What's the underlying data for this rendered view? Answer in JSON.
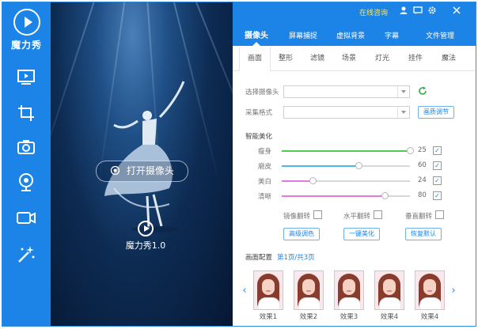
{
  "app": {
    "logo_text": "魔力秀",
    "brand_text": "魔力秀1.0",
    "accent": "#1b84e6"
  },
  "sidebar": {
    "items": [
      {
        "icon": "monitor-play-icon"
      },
      {
        "icon": "crop-screen-icon"
      },
      {
        "icon": "camera-icon"
      },
      {
        "icon": "webcam-icon"
      },
      {
        "icon": "video-camera-icon"
      },
      {
        "icon": "magic-wand-icon"
      }
    ]
  },
  "preview": {
    "open_camera_label": "打开摄像头"
  },
  "topbar": {
    "online_help": "在线咨询",
    "icons": [
      "user-icon",
      "message-icon",
      "gear-icon",
      "close-icon"
    ]
  },
  "tabs": [
    {
      "label": "摄像头",
      "active": true
    },
    {
      "label": "屏幕捕捉",
      "active": false
    },
    {
      "label": "虚拟背景",
      "active": false
    },
    {
      "label": "字幕",
      "active": false
    },
    {
      "label": "文件管理",
      "active": false
    }
  ],
  "subtabs": [
    {
      "label": "画面",
      "active": true
    },
    {
      "label": "整形",
      "active": false
    },
    {
      "label": "滤镜",
      "active": false
    },
    {
      "label": "场景",
      "active": false
    },
    {
      "label": "灯光",
      "active": false
    },
    {
      "label": "挂件",
      "active": false
    },
    {
      "label": "魔法",
      "active": false
    }
  ],
  "form": {
    "camera_label": "选择摄像头",
    "camera_value": "",
    "format_label": "采集格式",
    "format_value": "",
    "quality_button": "画质调节"
  },
  "beauty": {
    "title": "智能美化",
    "sliders": [
      {
        "label": "瘦身",
        "value": 25,
        "fill_fraction": 1.0,
        "color": "#4fcf4f",
        "checked": true
      },
      {
        "label": "磨皮",
        "value": 60,
        "fill_fraction": 0.6,
        "color": "#4db8e8",
        "checked": true
      },
      {
        "label": "美白",
        "value": 24,
        "fill_fraction": 0.24,
        "color": "#e27be0",
        "checked": true
      },
      {
        "label": "清晰",
        "value": 80,
        "fill_fraction": 0.8,
        "color": "#e27be0",
        "checked": true
      }
    ],
    "mirror_label": "镜像翻转",
    "hflip_label": "水平翻转",
    "vflip_label": "垂直翻转",
    "advanced_button": "高级调色",
    "auto_button": "一键美化",
    "reset_button": "恢复默认"
  },
  "filters": {
    "title": "画面配置",
    "page_text": "第1页/共3页",
    "items": [
      "效果1",
      "效果2",
      "效果3",
      "效果4",
      "效果4"
    ]
  }
}
